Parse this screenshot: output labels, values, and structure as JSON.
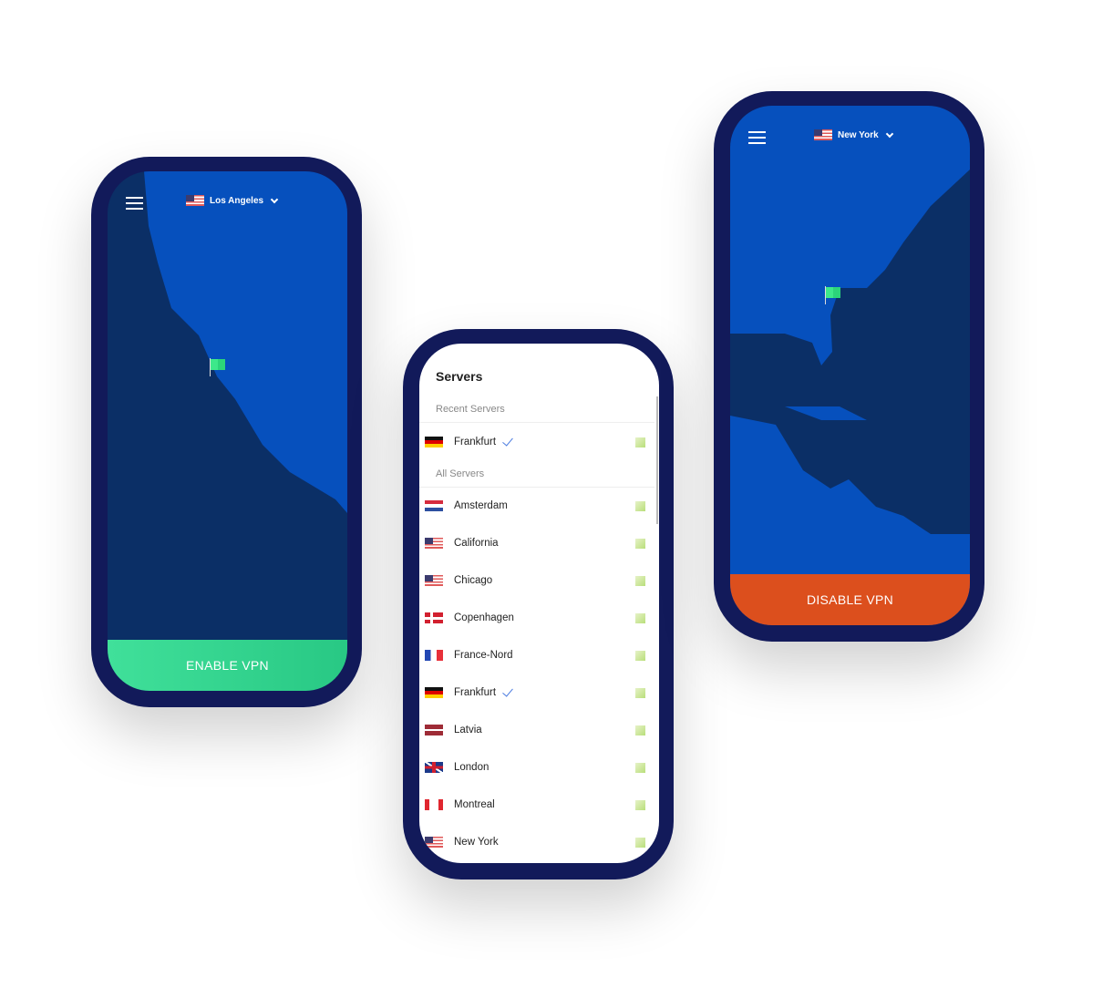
{
  "left_phone": {
    "location": "Los Angeles",
    "location_flag": "us",
    "button": "ENABLE VPN",
    "button_color": "#34d68f"
  },
  "middle_phone": {
    "title": "Servers",
    "recent_label": "Recent Servers",
    "recent": [
      {
        "name": "Frankfurt",
        "flag": "de",
        "selected": true
      }
    ],
    "all_label": "All Servers",
    "servers": [
      {
        "name": "Amsterdam",
        "flag": "nl",
        "selected": false
      },
      {
        "name": "California",
        "flag": "us",
        "selected": false
      },
      {
        "name": "Chicago",
        "flag": "us",
        "selected": false
      },
      {
        "name": "Copenhagen",
        "flag": "dk",
        "selected": false
      },
      {
        "name": "France-Nord",
        "flag": "fr",
        "selected": false
      },
      {
        "name": "Frankfurt",
        "flag": "de",
        "selected": true
      },
      {
        "name": "Latvia",
        "flag": "lv",
        "selected": false
      },
      {
        "name": "London",
        "flag": "gb",
        "selected": false
      },
      {
        "name": "Montreal",
        "flag": "ca",
        "selected": false
      },
      {
        "name": "New York",
        "flag": "us",
        "selected": false
      }
    ]
  },
  "right_phone": {
    "location": "New York",
    "location_flag": "us",
    "button": "DISABLE VPN",
    "button_color": "#dc4f1d"
  },
  "colors": {
    "frame": "#121a5a",
    "land": "#0650bd",
    "sea": "#0b2f66"
  }
}
